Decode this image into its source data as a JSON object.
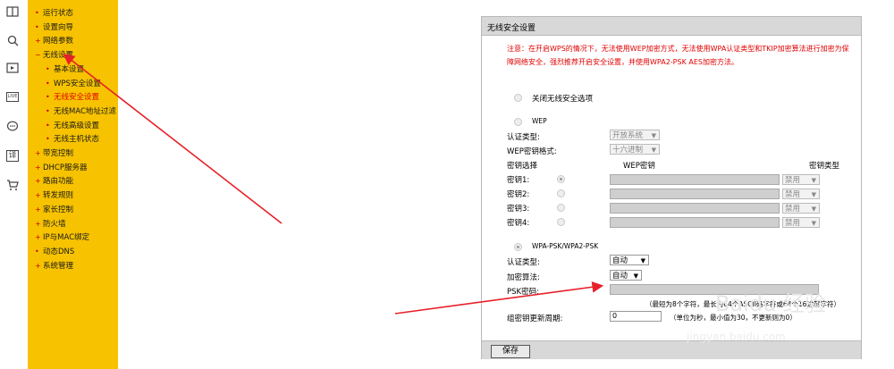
{
  "iconbar": {
    "icons": [
      "book-icon",
      "search-icon",
      "video-icon",
      "live-icon",
      "chat-icon",
      "translate-icon",
      "cart-icon"
    ],
    "live_label": "LIVE",
    "translate_label": "译"
  },
  "nav": {
    "items": [
      {
        "label": "运行状态",
        "level": 1,
        "marker": "•"
      },
      {
        "label": "设置向导",
        "level": 1,
        "marker": "•"
      },
      {
        "label": "网络参数",
        "level": 1,
        "marker": "+"
      },
      {
        "label": "无线设置",
        "level": 1,
        "marker": "−"
      },
      {
        "label": "基本设置",
        "level": 2,
        "marker": "•"
      },
      {
        "label": "WPS安全设置",
        "level": 2,
        "marker": "•"
      },
      {
        "label": "无线安全设置",
        "level": 2,
        "marker": "•",
        "active": true
      },
      {
        "label": "无线MAC地址过滤",
        "level": 2,
        "marker": "•"
      },
      {
        "label": "无线高级设置",
        "level": 2,
        "marker": "•"
      },
      {
        "label": "无线主机状态",
        "level": 2,
        "marker": "•"
      },
      {
        "label": "带宽控制",
        "level": 1,
        "marker": "+"
      },
      {
        "label": "DHCP服务器",
        "level": 1,
        "marker": "+"
      },
      {
        "label": "路由功能",
        "level": 1,
        "marker": "+"
      },
      {
        "label": "转发规则",
        "level": 1,
        "marker": "+"
      },
      {
        "label": "家长控制",
        "level": 1,
        "marker": "+"
      },
      {
        "label": "防火墙",
        "level": 1,
        "marker": "+"
      },
      {
        "label": "IP与MAC绑定",
        "level": 1,
        "marker": "+"
      },
      {
        "label": "动态DNS",
        "level": 1,
        "marker": "•"
      },
      {
        "label": "系统管理",
        "level": 1,
        "marker": "+"
      }
    ]
  },
  "panel": {
    "title": "无线安全设置",
    "notice": "注意：在开启WPS的情况下，无法使用WEP加密方式，无法使用WPA认证类型和TKIP加密算法进行加密为保障网络安全，强烈推荐开启安全设置，并使用WPA2-PSK AES加密方法。",
    "option_none": "关闭无线安全选项",
    "wep": {
      "label": "WEP",
      "auth_label": "认证类型:",
      "auth_value": "开放系统",
      "format_label": "WEP密钥格式:",
      "format_value": "十六进制",
      "col_select": "密钥选择",
      "col_key": "WEP密钥",
      "col_type": "密钥类型",
      "keys": [
        {
          "label": "密钥1:",
          "type": "禁用"
        },
        {
          "label": "密钥2:",
          "type": "禁用"
        },
        {
          "label": "密钥3:",
          "type": "禁用"
        },
        {
          "label": "密钥4:",
          "type": "禁用"
        }
      ]
    },
    "wpa": {
      "label": "WPA-PSK/WPA2-PSK",
      "auth_label": "认证类型:",
      "auth_value": "自动",
      "enc_label": "加密算法:",
      "enc_value": "自动",
      "psk_label": "PSK密码:",
      "psk_hint": "（最短为8个字符，最长为64个ASCII码字符或64个16进制字符）",
      "renew_label": "组密钥更新周期:",
      "renew_value": "0",
      "renew_hint": "（单位为秒，最小值为30，不更新则为0）"
    },
    "save_label": "保存"
  },
  "watermark": {
    "text": "Baidu 经验",
    "url_text": "jingyan.baidu.com"
  },
  "colors": {
    "nav_bg": "#f7c300",
    "notice": "#e00000",
    "arrow": "#e8202a"
  }
}
